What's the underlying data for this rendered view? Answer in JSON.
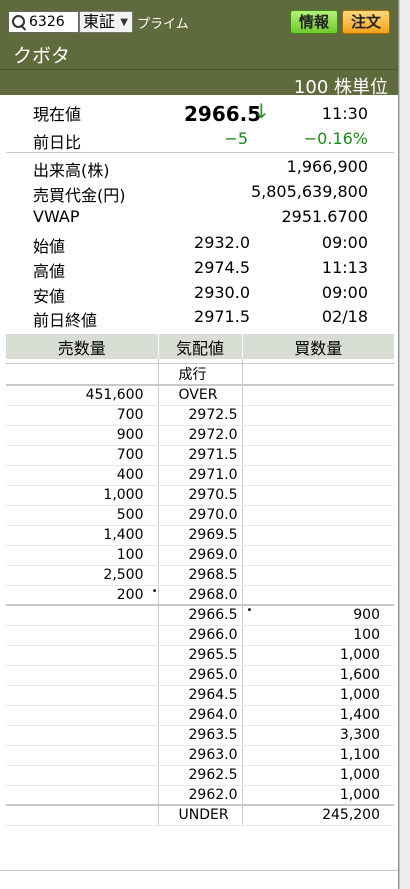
{
  "header": {
    "code": "6326",
    "exchange": "東証",
    "market": "プライム",
    "info_button": "情報",
    "order_button": "注文",
    "stock_name": "クボタ",
    "unit": "100 株単位"
  },
  "quote": {
    "current_label": "現在値",
    "current_price": "2966.5",
    "direction": "↓",
    "current_time": "11:30",
    "change_label": "前日比",
    "change": "−5",
    "change_pct": "−0.16%",
    "volume_label": "出来高(株)",
    "volume": "1,966,900",
    "turnover_label": "売買代金(円)",
    "turnover": "5,805,639,800",
    "vwap_label": "VWAP",
    "vwap": "2951.6700",
    "open_label": "始値",
    "open": "2932.0",
    "open_time": "09:00",
    "high_label": "高値",
    "high": "2974.5",
    "high_time": "11:13",
    "low_label": "安値",
    "low": "2930.0",
    "low_time": "09:00",
    "prev_close_label": "前日終値",
    "prev_close": "2971.5",
    "prev_close_date": "02/18"
  },
  "book": {
    "headers": [
      "売数量",
      "気配値",
      "買数量"
    ],
    "market_order": "成行",
    "over_label": "OVER",
    "over_qty": "451,600",
    "under_label": "UNDER",
    "under_qty": "245,200",
    "asks": [
      {
        "qty": "700",
        "price": "2972.5"
      },
      {
        "qty": "900",
        "price": "2972.0"
      },
      {
        "qty": "700",
        "price": "2971.5"
      },
      {
        "qty": "400",
        "price": "2971.0"
      },
      {
        "qty": "1,000",
        "price": "2970.5"
      },
      {
        "qty": "500",
        "price": "2970.0"
      },
      {
        "qty": "1,400",
        "price": "2969.5"
      },
      {
        "qty": "100",
        "price": "2969.0"
      },
      {
        "qty": "2,500",
        "price": "2968.5"
      },
      {
        "qty": "200",
        "price": "2968.0"
      }
    ],
    "bids": [
      {
        "price": "2966.5",
        "qty": "900"
      },
      {
        "price": "2966.0",
        "qty": "100"
      },
      {
        "price": "2965.5",
        "qty": "1,000"
      },
      {
        "price": "2965.0",
        "qty": "1,600"
      },
      {
        "price": "2964.5",
        "qty": "1,000"
      },
      {
        "price": "2964.0",
        "qty": "1,400"
      },
      {
        "price": "2963.5",
        "qty": "3,300"
      },
      {
        "price": "2963.0",
        "qty": "1,100"
      },
      {
        "price": "2962.5",
        "qty": "1,000"
      },
      {
        "price": "2962.0",
        "qty": "1,000"
      }
    ]
  },
  "colors": {
    "header_bg": "#5f6b3d",
    "down_green": "#1c8a1c",
    "table_header_bg": "#d9ded5"
  }
}
